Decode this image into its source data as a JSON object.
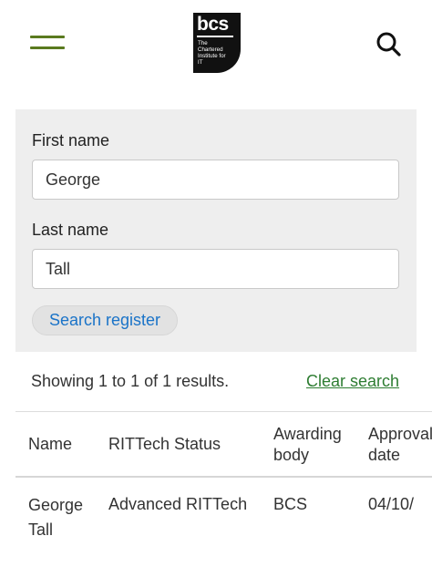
{
  "header": {
    "logo": {
      "mark": "bcs",
      "subtitle": "The Chartered Institute for IT"
    },
    "menu_icon": "hamburger-menu-icon",
    "search_icon": "search-icon",
    "accent_color": "#5a7a1f"
  },
  "form": {
    "first_name_label": "First name",
    "first_name_value": "George",
    "last_name_label": "Last name",
    "last_name_value": "Tall",
    "submit_label": "Search register"
  },
  "results": {
    "summary": "Showing 1 to 1 of 1 results.",
    "clear_label": "Clear search",
    "columns": [
      "Name",
      "RITTech Status",
      "Awarding body",
      "Approval date"
    ],
    "rows": [
      {
        "name": "George Tall",
        "status": "Advanced RITTech",
        "awarding_body": "BCS",
        "approval_date": "04/10/"
      }
    ]
  }
}
